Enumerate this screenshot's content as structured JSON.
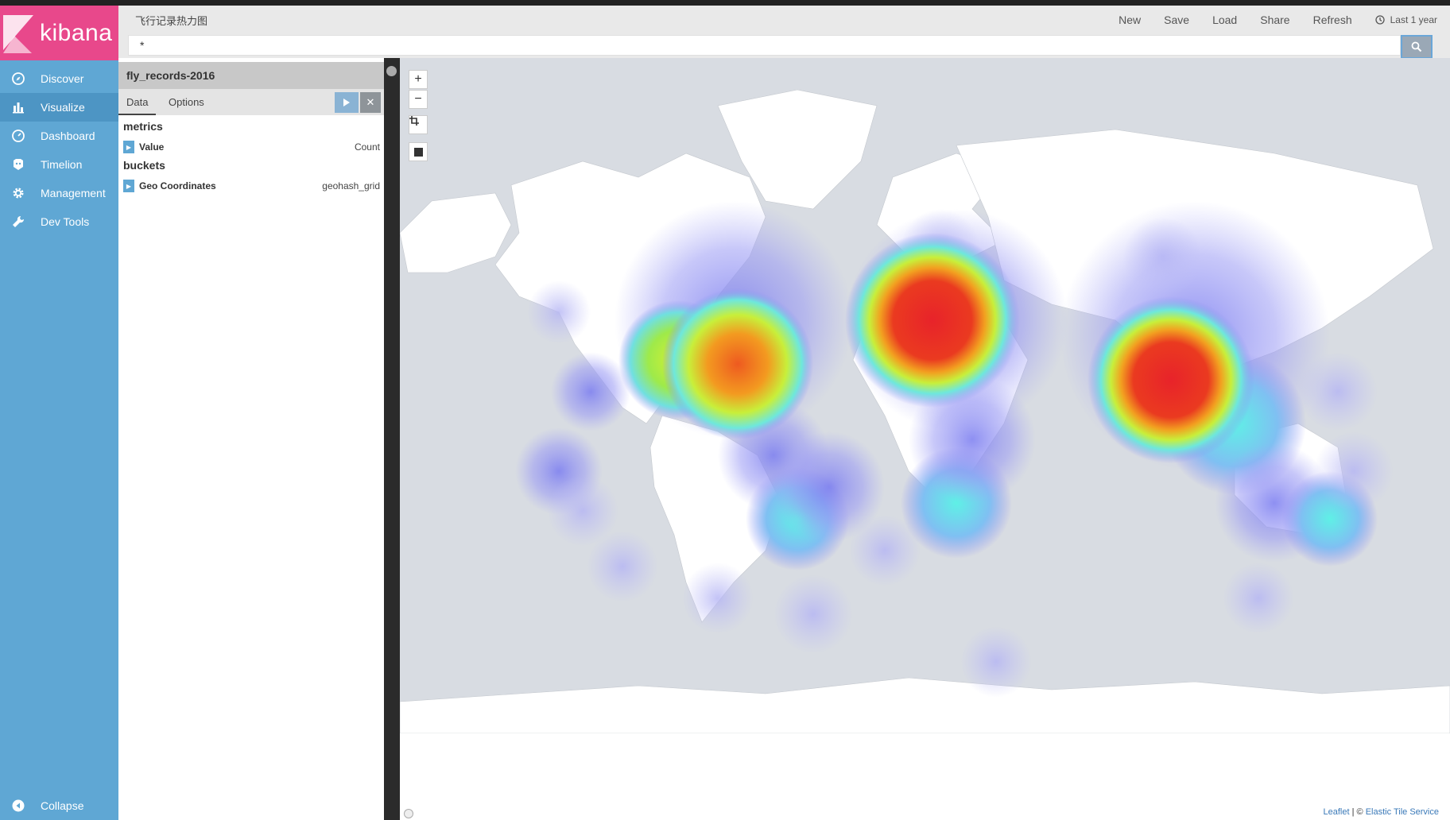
{
  "app": {
    "brand": "kibana"
  },
  "sidebar": {
    "items": [
      {
        "label": "Discover",
        "icon": "compass-icon"
      },
      {
        "label": "Visualize",
        "icon": "bar-chart-icon"
      },
      {
        "label": "Dashboard",
        "icon": "dashboard-icon"
      },
      {
        "label": "Timelion",
        "icon": "timelion-icon"
      },
      {
        "label": "Management",
        "icon": "gear-icon"
      },
      {
        "label": "Dev Tools",
        "icon": "wrench-icon"
      }
    ],
    "active": "Visualize",
    "collapse_label": "Collapse"
  },
  "header": {
    "title": "飞行记录热力图",
    "menu": {
      "new": "New",
      "save": "Save",
      "load": "Load",
      "share": "Share",
      "refresh": "Refresh"
    },
    "time": "Last 1 year",
    "query": "*"
  },
  "panel": {
    "index": "fly_records-2016",
    "tabs": {
      "data": "Data",
      "options": "Options"
    },
    "metrics_label": "metrics",
    "buckets_label": "buckets",
    "metric": {
      "name": "Value",
      "type": "Count"
    },
    "bucket": {
      "name": "Geo Coordinates",
      "type": "geohash_grid"
    }
  },
  "map": {
    "zoom_in": "+",
    "zoom_out": "−",
    "attribution": {
      "leaflet": "Leaflet",
      "sep": " | © ",
      "service": "Elastic Tile Service"
    }
  },
  "colors": {
    "sidebar": "#5fa7d4",
    "logo": "#e8488b",
    "ocean": "#d8dce2"
  }
}
